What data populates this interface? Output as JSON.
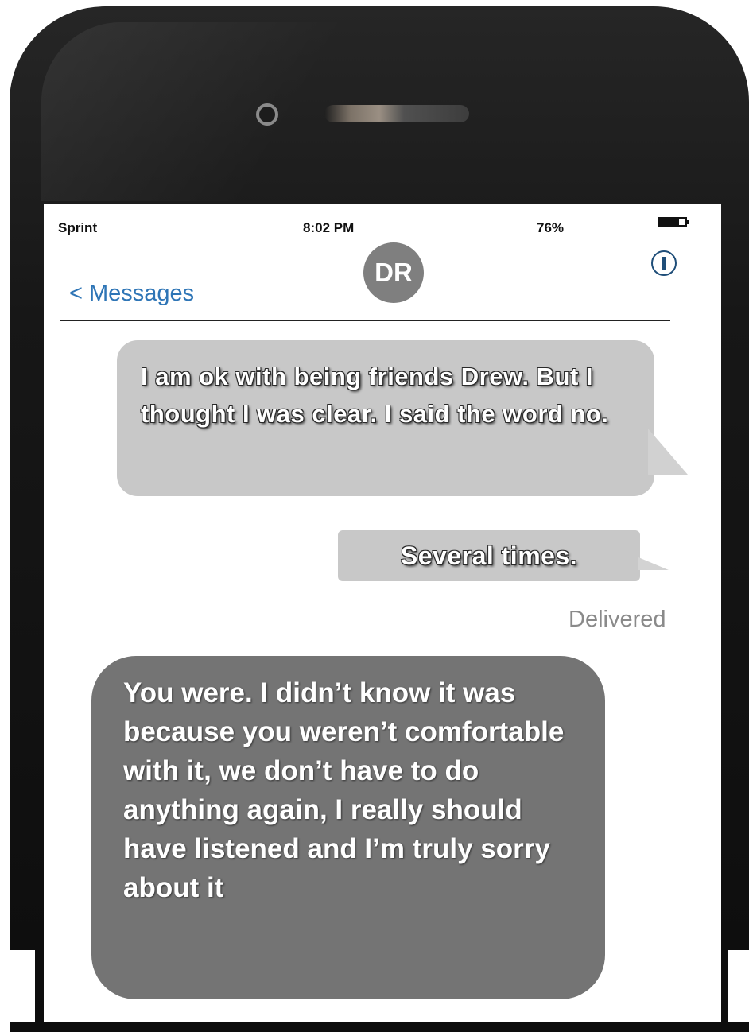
{
  "status_bar": {
    "carrier": "Sprint",
    "time": "8:02 PM",
    "battery": "76%"
  },
  "header": {
    "avatar_initials": "DR",
    "back_label": "< Messages",
    "info_icon": "info-circle-icon"
  },
  "messages": [
    {
      "direction": "outgoing",
      "text": "I am ok with being friends Drew.  But I thought I was clear. I said the word no."
    },
    {
      "direction": "outgoing",
      "text": "Several times."
    },
    {
      "direction": "incoming",
      "text": "You were. I didn’t know it was because you weren’t comfortable with it, we don’t have to do anything again, I really should have listened and I’m truly sorry about it"
    }
  ],
  "delivery_status": "Delivered",
  "colors": {
    "link_blue": "#2e75b6",
    "outgoing_bubble": "#c8c8c8",
    "incoming_bubble": "#747474",
    "avatar": "#7f7f7f"
  }
}
